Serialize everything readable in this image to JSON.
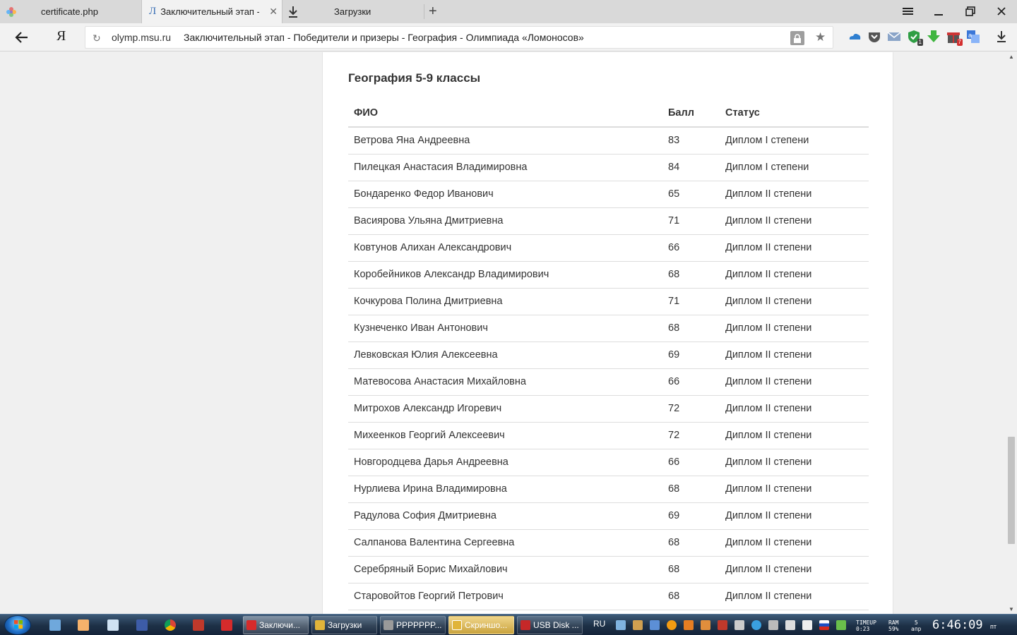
{
  "browser": {
    "tabs": [
      {
        "title": "certificate.php"
      },
      {
        "title": "Заключительный этап - П"
      },
      {
        "title": "Загрузки"
      }
    ],
    "address": {
      "domain": "olymp.msu.ru",
      "title": "Заключительный этап - Победители и призеры - География - Олимпиада «Ломоносов»"
    },
    "yandex_label": "Я",
    "extensions": [
      {
        "name": "cloud-icon",
        "color": "#2f7fd0"
      },
      {
        "name": "pocket-icon",
        "color": "#555555"
      },
      {
        "name": "mail-icon",
        "color": "#8aa4c8"
      },
      {
        "name": "shield-icon",
        "color": "#2f9e44",
        "badge": "1"
      },
      {
        "name": "download-arrow-icon",
        "color": "#3fb53f"
      },
      {
        "name": "gift-icon",
        "color": "#cc3333",
        "badge": "7"
      },
      {
        "name": "translate-icon",
        "color": "#3b77d8"
      }
    ]
  },
  "page": {
    "section_title": "География 5-9 классы",
    "columns": {
      "name": "ФИО",
      "score": "Балл",
      "status": "Статус"
    },
    "rows": [
      {
        "name": "Ветрова Яна Андреевна",
        "score": "83",
        "status": "Диплом I степени"
      },
      {
        "name": "Пилецкая Анастасия Владимировна",
        "score": "84",
        "status": "Диплом I степени"
      },
      {
        "name": "Бондаренко Федор Иванович",
        "score": "65",
        "status": "Диплом II степени"
      },
      {
        "name": "Васиярова Ульяна Дмитриевна",
        "score": "71",
        "status": "Диплом II степени"
      },
      {
        "name": "Ковтунов Алихан Александрович",
        "score": "66",
        "status": "Диплом II степени"
      },
      {
        "name": "Коробейников Александр Владимирович",
        "score": "68",
        "status": "Диплом II степени"
      },
      {
        "name": "Кочкурова Полина Дмитриевна",
        "score": "71",
        "status": "Диплом II степени"
      },
      {
        "name": "Кузнеченко Иван Антонович",
        "score": "68",
        "status": "Диплом II степени"
      },
      {
        "name": "Левковская Юлия Алексеевна",
        "score": "69",
        "status": "Диплом II степени"
      },
      {
        "name": "Матевосова Анастасия Михайловна",
        "score": "66",
        "status": "Диплом II степени"
      },
      {
        "name": "Митрохов Александр Игоревич",
        "score": "72",
        "status": "Диплом II степени"
      },
      {
        "name": "Михеенков Георгий Алексеевич",
        "score": "72",
        "status": "Диплом II степени"
      },
      {
        "name": "Новгородцева Дарья Андреевна",
        "score": "66",
        "status": "Диплом II степени"
      },
      {
        "name": "Нурлиева Ирина Владимировна",
        "score": "68",
        "status": "Диплом II степени"
      },
      {
        "name": "Радулова София Дмитриевна",
        "score": "69",
        "status": "Диплом II степени"
      },
      {
        "name": "Салпанова Валентина Сергеевна",
        "score": "68",
        "status": "Диплом II степени"
      },
      {
        "name": "Серебряный Борис Михайлович",
        "score": "68",
        "status": "Диплом II степени"
      },
      {
        "name": "Старовойтов Георгий Петрович",
        "score": "68",
        "status": "Диплом II степени"
      }
    ]
  },
  "taskbar": {
    "items": [
      {
        "label": "Заключи...",
        "color": "#d62b2b"
      },
      {
        "label": "Загрузки",
        "color": "#e0b43a"
      },
      {
        "label": "PPPPPPP...",
        "color": "#9a9a9a"
      },
      {
        "label": "Скриншо...",
        "color": "#e0b43a"
      },
      {
        "label": "USB Disk ...",
        "color": "#c62828"
      }
    ],
    "language": "RU",
    "timeup_label": "TIMEUP",
    "timeup_value": "0:23",
    "ram_label": "RAM",
    "ram_value": "59%",
    "date_day": "5",
    "date_month": "апр",
    "clock": "6:46:09",
    "weekday": "пт"
  }
}
